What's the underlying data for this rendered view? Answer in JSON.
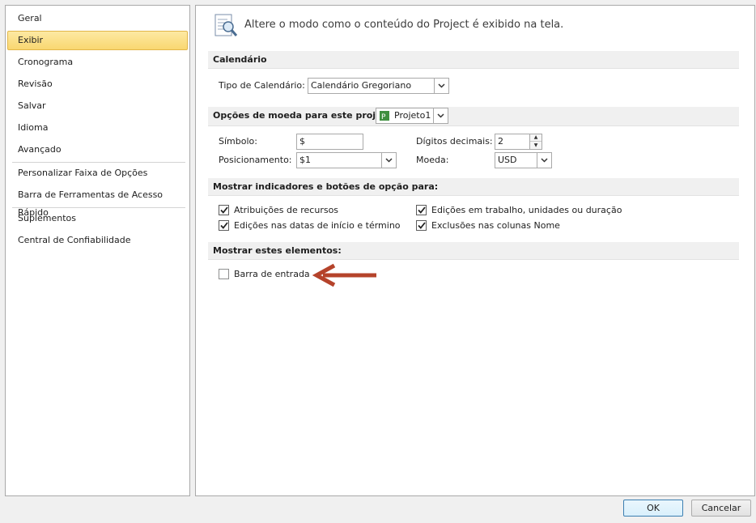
{
  "sidebar": {
    "items": [
      {
        "label": "Geral"
      },
      {
        "label": "Exibir"
      },
      {
        "label": "Cronograma"
      },
      {
        "label": "Revisão"
      },
      {
        "label": "Salvar"
      },
      {
        "label": "Idioma"
      },
      {
        "label": "Avançado"
      },
      {
        "label": "Personalizar Faixa de Opções"
      },
      {
        "label": "Barra de Ferramentas de Acesso Rápido"
      },
      {
        "label": "Suplementos"
      },
      {
        "label": "Central de Confiabilidade"
      }
    ],
    "selected": "Exibir"
  },
  "header": {
    "text": "Altere o modo como o conteúdo do Project é exibido na tela.",
    "icon": "display-options-icon"
  },
  "calendar": {
    "section_title": "Calendário",
    "type_label": "Tipo de Calendário:",
    "type_value": "Calendário Gregoriano"
  },
  "currency": {
    "section_title": "Opções de moeda para este projeto:",
    "project_value": "Projeto1",
    "symbol_label": "Símbolo:",
    "symbol_value": "$",
    "position_label": "Posicionamento:",
    "position_value": "$1",
    "decimals_label": "Dígitos decimais:",
    "decimals_value": "2",
    "currency_label": "Moeda:",
    "currency_value": "USD"
  },
  "indicators": {
    "section_title": "Mostrar indicadores e botões de opção para:",
    "options": [
      {
        "label": "Atribuições de recursos",
        "checked": true
      },
      {
        "label": "Edições nas datas de início e término",
        "checked": true
      },
      {
        "label": "Edições em trabalho, unidades ou duração",
        "checked": true
      },
      {
        "label": "Exclusões nas colunas Nome",
        "checked": true
      }
    ]
  },
  "elements": {
    "section_title": "Mostrar estes elementos:",
    "entry_bar_label": "Barra de entrada",
    "entry_bar_checked": false
  },
  "annotation": {
    "arrow_color": "#b5432b"
  },
  "footer": {
    "ok_label": "OK",
    "cancel_label": "Cancelar"
  },
  "colors": {
    "selected_bg": "#f9d770",
    "section_bg": "#f0f0f0"
  }
}
